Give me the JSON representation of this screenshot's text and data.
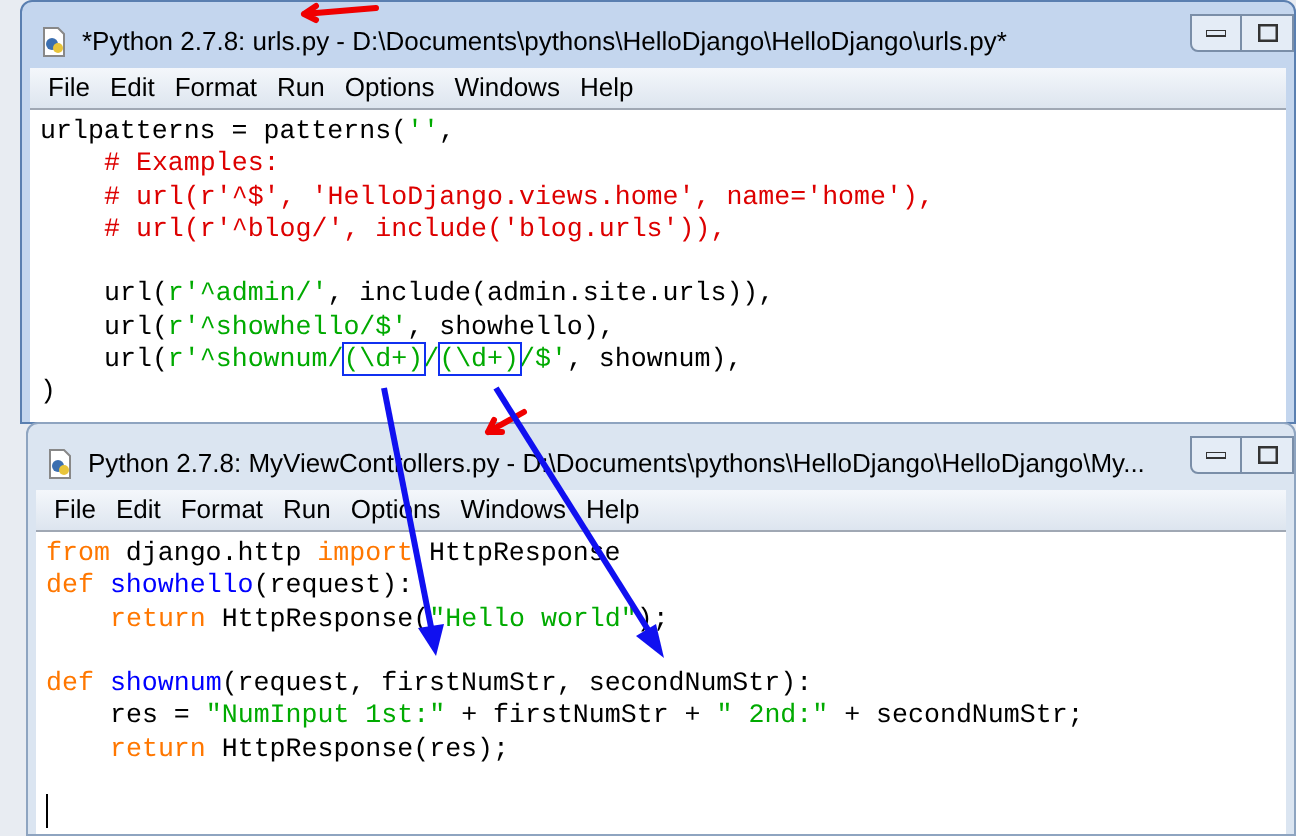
{
  "windows": [
    {
      "title": "*Python 2.7.8: urls.py - D:\\Documents\\pythons\\HelloDjango\\HelloDjango\\urls.py*",
      "focused": true,
      "menu": [
        "File",
        "Edit",
        "Format",
        "Run",
        "Options",
        "Windows",
        "Help"
      ],
      "lines": [
        {
          "indented": false,
          "blank_before": false,
          "tokens": [
            {
              "kind": "plain",
              "text": "urlpatterns = patterns("
            },
            {
              "kind": "string",
              "text": "''"
            },
            {
              "kind": "plain",
              "text": ","
            }
          ]
        },
        {
          "indented": true,
          "blank_before": false,
          "tokens": [
            {
              "kind": "comment",
              "text": "# Examples:"
            }
          ]
        },
        {
          "indented": true,
          "blank_before": false,
          "tokens": [
            {
              "kind": "comment",
              "text": "# url(r'^$', 'HelloDjango.views.home', name='home'),"
            }
          ]
        },
        {
          "indented": true,
          "blank_before": false,
          "tokens": [
            {
              "kind": "comment",
              "text": "# url(r'^blog/', include('blog.urls')),"
            }
          ]
        },
        {
          "indented": true,
          "blank_before": true,
          "tokens": [
            {
              "kind": "plain",
              "text": "url("
            },
            {
              "kind": "string",
              "text": "r'^admin/'"
            },
            {
              "kind": "plain",
              "text": ", include(admin.site.urls)),"
            }
          ]
        },
        {
          "indented": true,
          "blank_before": false,
          "tokens": [
            {
              "kind": "plain",
              "text": "url("
            },
            {
              "kind": "string",
              "text": "r'^showhello/$'"
            },
            {
              "kind": "plain",
              "text": ", showhello),"
            }
          ]
        },
        {
          "indented": true,
          "blank_before": false,
          "tokens": [
            {
              "kind": "plain",
              "text": "url("
            },
            {
              "kind": "string",
              "text": "r'^shownum/"
            },
            {
              "kind": "string",
              "text": "(\\d+)",
              "boxed": true
            },
            {
              "kind": "string",
              "text": "/"
            },
            {
              "kind": "string",
              "text": "(\\d+)",
              "boxed": true
            },
            {
              "kind": "string",
              "text": "/$'"
            },
            {
              "kind": "plain",
              "text": ", shownum),"
            }
          ]
        },
        {
          "indented": false,
          "blank_before": false,
          "tokens": [
            {
              "kind": "plain",
              "text": ")"
            }
          ]
        }
      ]
    },
    {
      "title": "Python 2.7.8: MyViewControllers.py - D:\\Documents\\pythons\\HelloDjango\\HelloDjango\\My...",
      "focused": false,
      "menu": [
        "File",
        "Edit",
        "Format",
        "Run",
        "Options",
        "Windows",
        "Help"
      ],
      "lines": [
        {
          "indented": false,
          "blank_before": false,
          "tokens": [
            {
              "kind": "keyword",
              "text": "from"
            },
            {
              "kind": "plain",
              "text": " django.http "
            },
            {
              "kind": "keyword",
              "text": "import"
            },
            {
              "kind": "plain",
              "text": " HttpResponse"
            }
          ]
        },
        {
          "indented": false,
          "blank_before": false,
          "tokens": [
            {
              "kind": "keyword",
              "text": "def"
            },
            {
              "kind": "definition",
              "text": "showhello"
            },
            {
              "kind": "plain",
              "text": "(request):"
            }
          ]
        },
        {
          "indented": true,
          "blank_before": false,
          "tokens": [
            {
              "kind": "keyword",
              "text": "return"
            },
            {
              "kind": "plain",
              "text": " HttpResponse("
            },
            {
              "kind": "string",
              "text": "\"Hello world\""
            },
            {
              "kind": "plain",
              "text": ");"
            }
          ]
        },
        {
          "indented": false,
          "blank_before": true,
          "tokens": [
            {
              "kind": "keyword",
              "text": "def"
            },
            {
              "kind": "definition",
              "text": "shownum"
            },
            {
              "kind": "plain",
              "text": "(request, firstNumStr, secondNumStr):"
            }
          ]
        },
        {
          "indented": true,
          "blank_before": false,
          "tokens": [
            {
              "kind": "plain",
              "text": "res = "
            },
            {
              "kind": "string",
              "text": "\"NumInput 1st:\""
            },
            {
              "kind": "plain",
              "text": " + firstNumStr + "
            },
            {
              "kind": "string",
              "text": "\" 2nd:\""
            },
            {
              "kind": "plain",
              "text": " + secondNumStr;"
            }
          ]
        },
        {
          "indented": true,
          "blank_before": false,
          "tokens": [
            {
              "kind": "keyword",
              "text": "return"
            },
            {
              "kind": "plain",
              "text": " HttpResponse(res);"
            }
          ]
        }
      ]
    }
  ]
}
